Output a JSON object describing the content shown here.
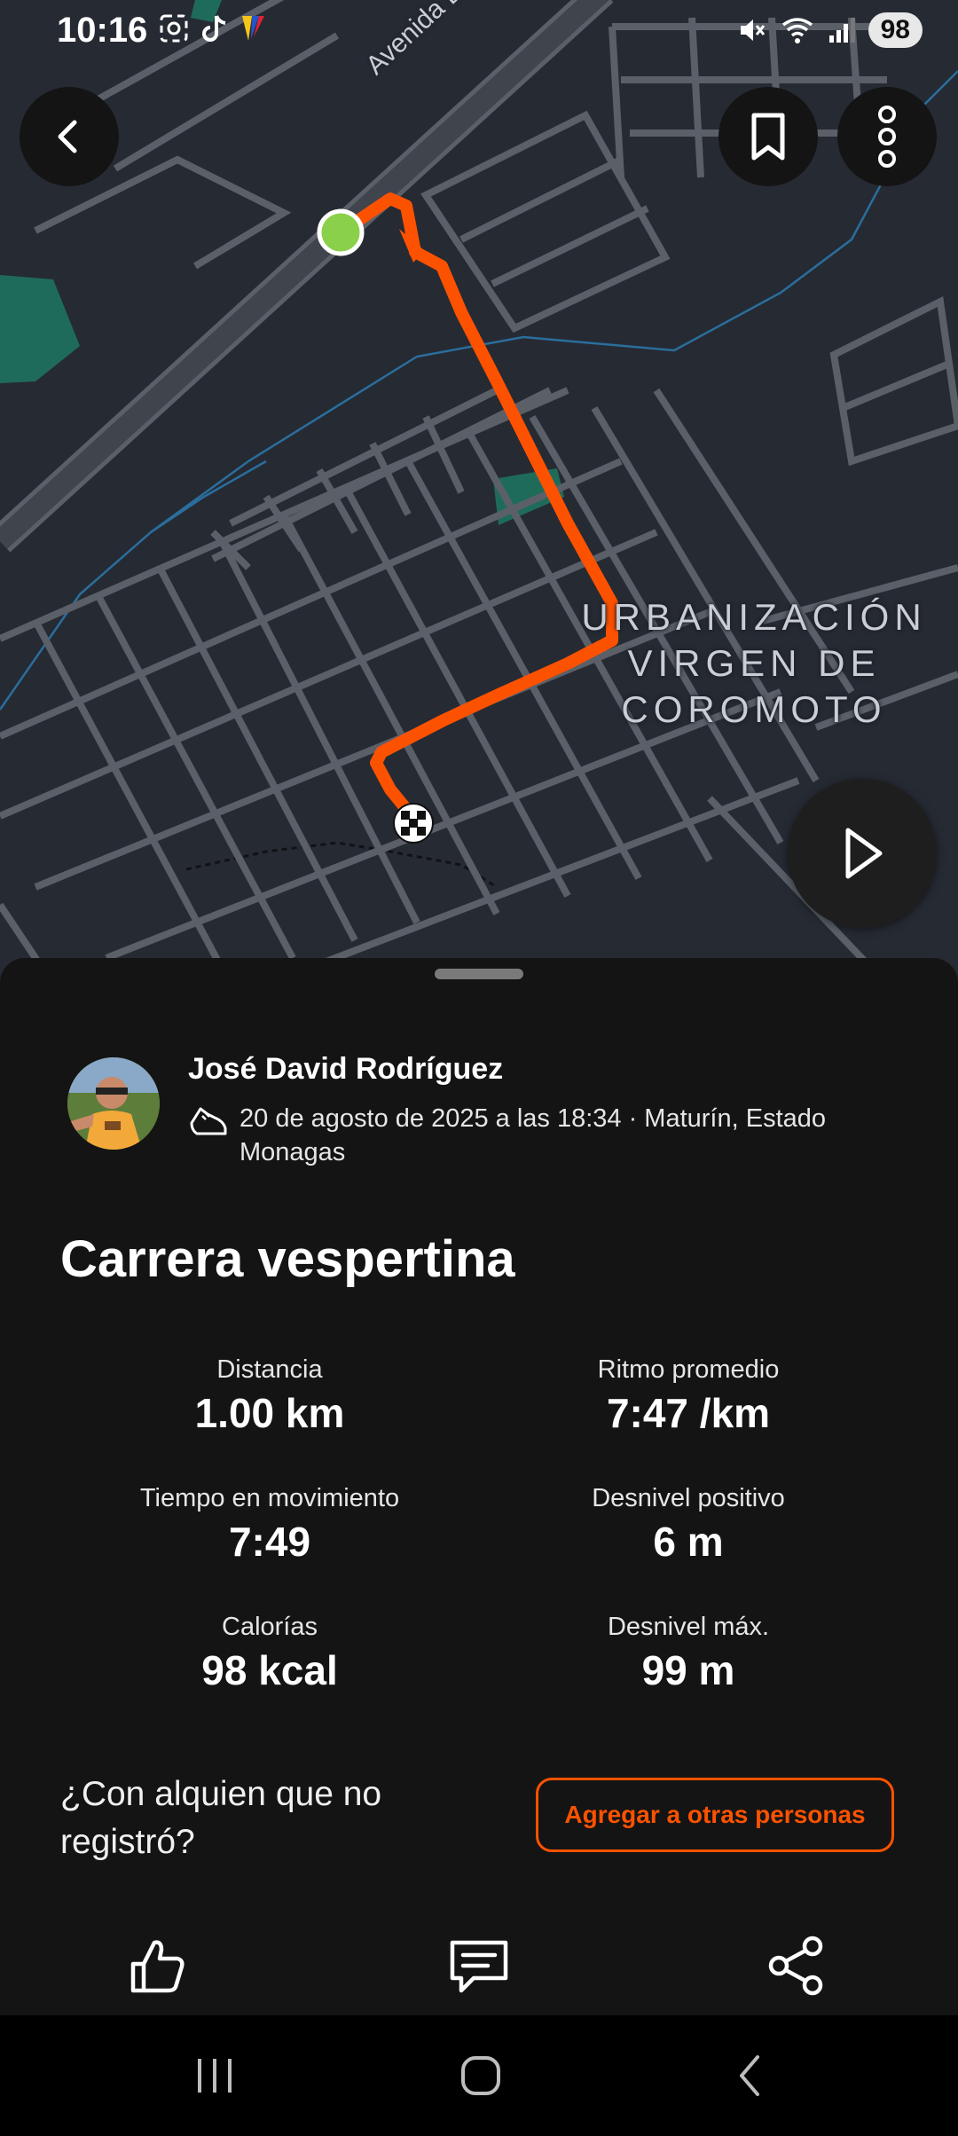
{
  "status_bar": {
    "time": "10:16",
    "battery": "98",
    "left_icons": [
      "screenshot-icon",
      "tiktok-icon",
      "color-flag-icon"
    ],
    "right_icons": [
      "mute-icon",
      "wifi-icon",
      "signal-icon"
    ]
  },
  "map": {
    "street_name": "Avenida Bella Vi",
    "area_label_line1": "URBANIZACIÓN",
    "area_label_line2": "VIRGEN DE",
    "area_label_line3": "COROMOTO",
    "route_color": "#fc5200",
    "start_marker_color": "#8bd04a"
  },
  "header_buttons": {
    "back": "back-arrow-icon",
    "bookmark": "bookmark-icon",
    "more": "more-vertical-icon",
    "play": "play-icon"
  },
  "athlete": {
    "name": "José David Rodríguez",
    "meta": "20 de agosto de 2025 a las 18:34 · Maturín, Estado Monagas",
    "activity_icon": "running-shoe-icon"
  },
  "activity": {
    "title": "Carrera vespertina"
  },
  "stats": [
    {
      "label": "Distancia",
      "value": "1.00 km"
    },
    {
      "label": "Ritmo promedio",
      "value": "7:47 /km"
    },
    {
      "label": "Tiempo en movimiento",
      "value": "7:49"
    },
    {
      "label": "Desnivel positivo",
      "value": "6 m"
    },
    {
      "label": "Calorías",
      "value": "98 kcal"
    },
    {
      "label": "Desnivel máx.",
      "value": "99 m"
    }
  ],
  "untracked": {
    "question": "¿Con alquien que no registró?",
    "button": "Agregar a otras personas"
  },
  "actions": {
    "like": "thumbs-up-icon",
    "comment": "comment-icon",
    "share": "share-icon"
  },
  "navigation_bar": {
    "recents": "recents-icon",
    "home": "home-icon",
    "back": "back-icon"
  },
  "colors": {
    "accent": "#fc5200",
    "sheet_background": "#141414",
    "map_background": "#262a33"
  }
}
